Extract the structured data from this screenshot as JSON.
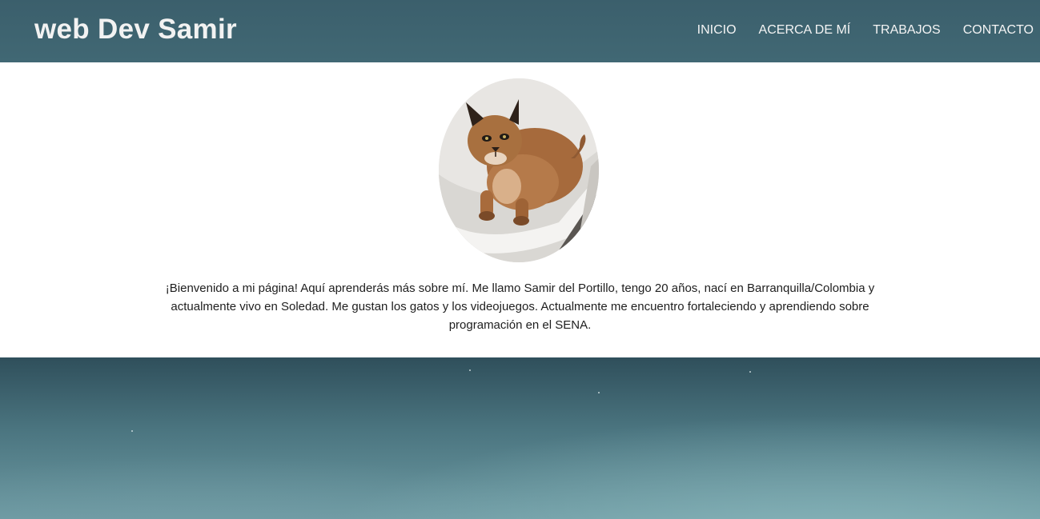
{
  "header": {
    "title": "web Dev Samir",
    "nav": [
      {
        "label": "INICIO"
      },
      {
        "label": "ACERCA DE MÍ"
      },
      {
        "label": "TRABAJOS"
      },
      {
        "label": "CONTACTO"
      }
    ]
  },
  "about": {
    "avatar_icon": "profile-photo-caracal",
    "bio": "¡Bienvenido a mi página! Aquí aprenderás más sobre mí. Me llamo Samir del Portillo, tengo 20 años, nací en Barranquilla/Colombia y actualmente vivo en Soledad. Me gustan los gatos y los videojuegos. Actualmente me encuentro fortaleciendo y aprendiendo sobre programación en el SENA."
  },
  "colors": {
    "header_bg": "#3d626e",
    "nav_text": "#f4f4f4",
    "hero_top": "#2f4f5b",
    "hero_bottom": "#6d9aa2"
  }
}
